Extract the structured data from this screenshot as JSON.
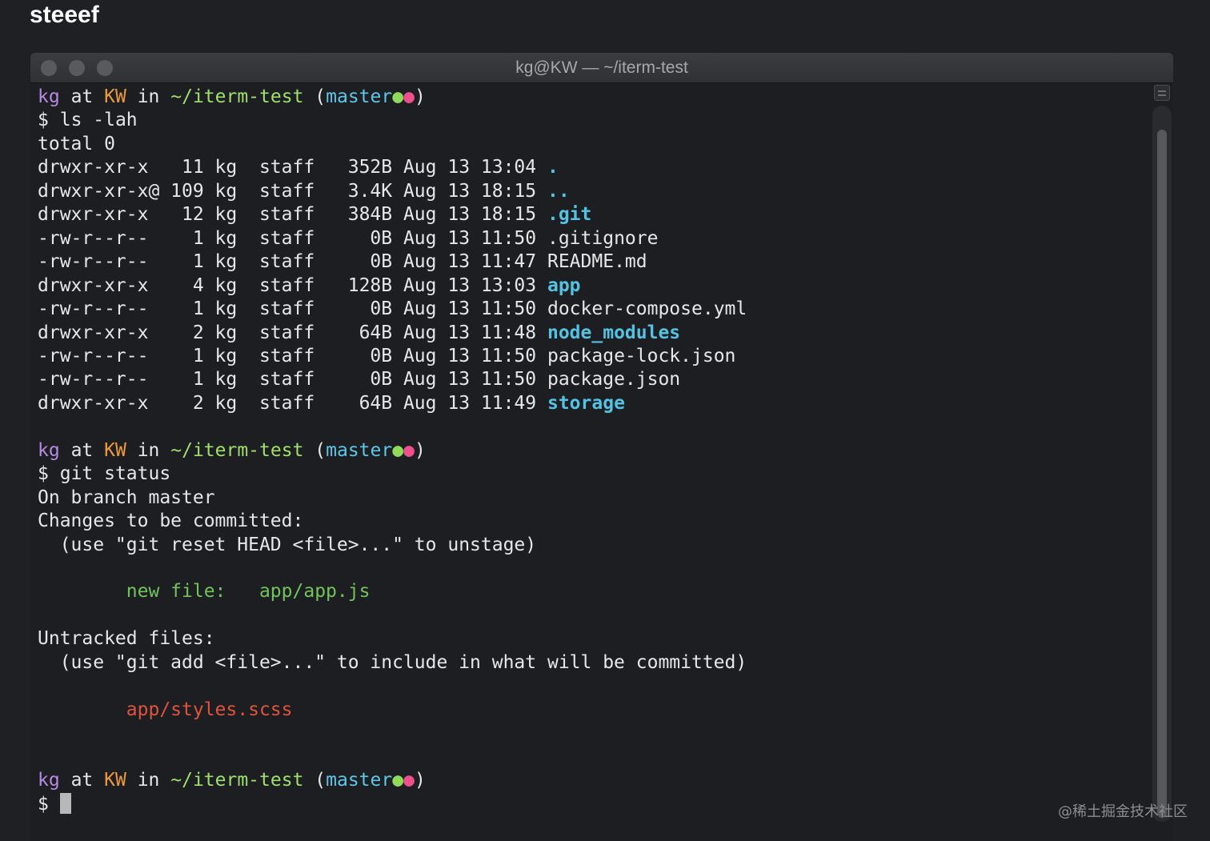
{
  "page_header": "steeef",
  "window": {
    "title": "kg@KW — ~/iterm-test",
    "buttons": {
      "close": "close",
      "minimize": "minimize",
      "zoom": "zoom"
    }
  },
  "prompt": {
    "user": "kg",
    "at": "at",
    "host": "KW",
    "in": "in",
    "path": "~/iterm-test",
    "branch": "master",
    "dot_staged": "●",
    "dot_untracked": "●",
    "symbol": "$"
  },
  "session": {
    "cmd1": "ls -lah",
    "total": "total 0",
    "listing": [
      {
        "meta": "drwxr-xr-x   11 kg  staff   352B Aug 13 13:04 ",
        "name": ".",
        "dir": true
      },
      {
        "meta": "drwxr-xr-x@ 109 kg  staff   3.4K Aug 13 18:15 ",
        "name": "..",
        "dir": true
      },
      {
        "meta": "drwxr-xr-x   12 kg  staff   384B Aug 13 18:15 ",
        "name": ".git",
        "dir": true
      },
      {
        "meta": "-rw-r--r--    1 kg  staff     0B Aug 13 11:50 ",
        "name": ".gitignore",
        "dir": false
      },
      {
        "meta": "-rw-r--r--    1 kg  staff     0B Aug 13 11:47 ",
        "name": "README.md",
        "dir": false
      },
      {
        "meta": "drwxr-xr-x    4 kg  staff   128B Aug 13 13:03 ",
        "name": "app",
        "dir": true
      },
      {
        "meta": "-rw-r--r--    1 kg  staff     0B Aug 13 11:50 ",
        "name": "docker-compose.yml",
        "dir": false
      },
      {
        "meta": "drwxr-xr-x    2 kg  staff    64B Aug 13 11:48 ",
        "name": "node_modules",
        "dir": true
      },
      {
        "meta": "-rw-r--r--    1 kg  staff     0B Aug 13 11:50 ",
        "name": "package-lock.json",
        "dir": false
      },
      {
        "meta": "-rw-r--r--    1 kg  staff     0B Aug 13 11:50 ",
        "name": "package.json",
        "dir": false
      },
      {
        "meta": "drwxr-xr-x    2 kg  staff    64B Aug 13 11:49 ",
        "name": "storage",
        "dir": true
      }
    ],
    "cmd2": "git status",
    "git_status": {
      "branch_line": "On branch master",
      "staged_header": "Changes to be committed:",
      "staged_hint": "  (use \"git reset HEAD <file>...\" to unstage)",
      "new_file_label": "        new file:   ",
      "new_file_path": "app/app.js",
      "untracked_header": "Untracked files:",
      "untracked_hint": "  (use \"git add <file>...\" to include in what will be committed)",
      "untracked_path": "        app/styles.scss"
    }
  },
  "watermark": "@稀土掘金技术社区"
}
